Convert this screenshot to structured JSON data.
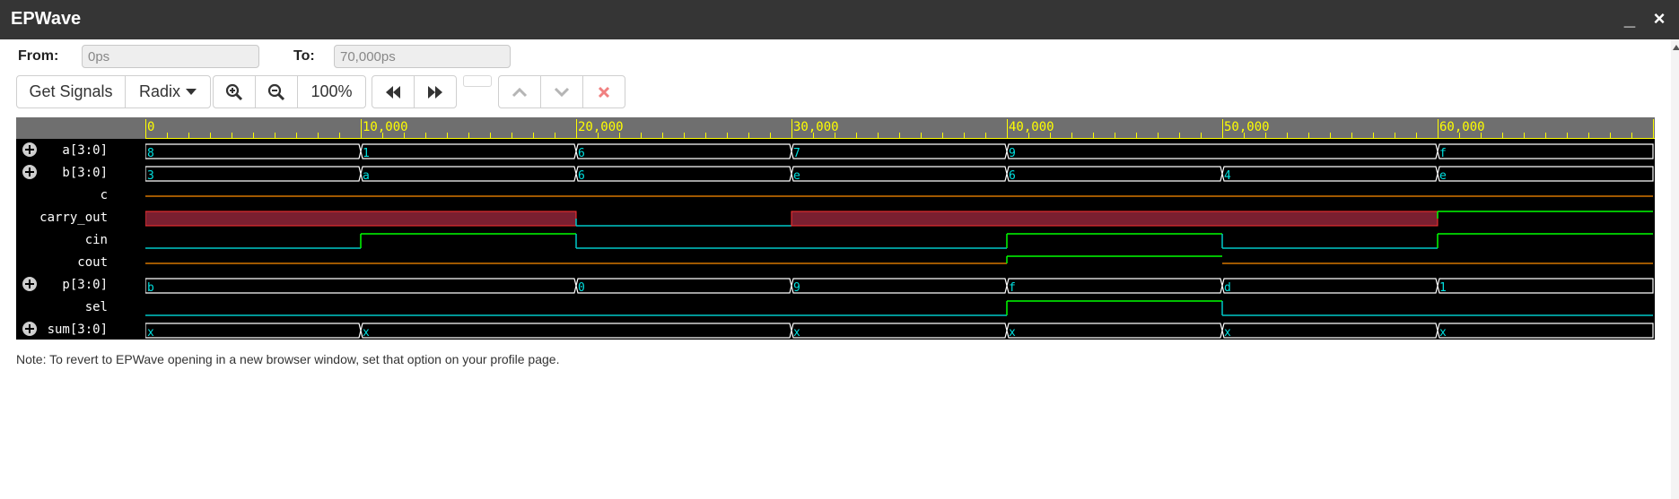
{
  "window": {
    "title": "EPWave",
    "minimize_glyph": "_",
    "close_glyph": "×"
  },
  "range": {
    "from_label": "From:",
    "from_value": "0ps",
    "to_label": "To:",
    "to_value": "70,000ps"
  },
  "toolbar": {
    "get_signals_label": "Get Signals",
    "radix_label": "Radix",
    "zoom_level": "100%",
    "icons": [
      "zoom-in-icon",
      "zoom-out-icon",
      "rewind-icon",
      "fast-forward-icon",
      "chevron-up-icon",
      "chevron-down-icon",
      "close-icon"
    ]
  },
  "waveform": {
    "time_start": 0,
    "time_end": 70000,
    "time_unit": "ps",
    "ruler_labels": [
      "0",
      "10,000",
      "20,000",
      "30,000",
      "40,000",
      "50,000",
      "60,000"
    ],
    "colors": {
      "background": "#000000",
      "bus": "#ffffff",
      "bus_value_text": "#00e0e0",
      "ruler": "#6f6f6f",
      "ruler_text": "#ffff00",
      "zero_line": "#00c8c8",
      "one_line": "#00ff00",
      "undefined_line": "#ff8c00",
      "unknown_fill": "#7a1f30",
      "unknown_edge": "#ff3030"
    },
    "signals": [
      {
        "name": "a[3:0]",
        "kind": "bus",
        "expandable": true,
        "segments": [
          {
            "start": 0,
            "value": "8"
          },
          {
            "start": 10000,
            "value": "1"
          },
          {
            "start": 20000,
            "value": "6"
          },
          {
            "start": 30000,
            "value": "7"
          },
          {
            "start": 40000,
            "value": "9"
          },
          {
            "start": 60000,
            "value": "f"
          }
        ]
      },
      {
        "name": "b[3:0]",
        "kind": "bus",
        "expandable": true,
        "segments": [
          {
            "start": 0,
            "value": "3"
          },
          {
            "start": 10000,
            "value": "a"
          },
          {
            "start": 20000,
            "value": "6"
          },
          {
            "start": 30000,
            "value": "e"
          },
          {
            "start": 40000,
            "value": "6"
          },
          {
            "start": 50000,
            "value": "4"
          },
          {
            "start": 60000,
            "value": "e"
          }
        ]
      },
      {
        "name": "c",
        "kind": "bit",
        "expandable": false,
        "segments": [
          {
            "start": 0,
            "value": "z"
          }
        ]
      },
      {
        "name": "carry_out",
        "kind": "bit",
        "expandable": false,
        "segments": [
          {
            "start": 0,
            "value": "x"
          },
          {
            "start": 20000,
            "value": "0"
          },
          {
            "start": 30000,
            "value": "x"
          },
          {
            "start": 60000,
            "value": "1"
          }
        ]
      },
      {
        "name": "cin",
        "kind": "bit",
        "expandable": false,
        "segments": [
          {
            "start": 0,
            "value": "0"
          },
          {
            "start": 10000,
            "value": "1"
          },
          {
            "start": 20000,
            "value": "0"
          },
          {
            "start": 40000,
            "value": "1"
          },
          {
            "start": 50000,
            "value": "0"
          },
          {
            "start": 60000,
            "value": "1"
          }
        ]
      },
      {
        "name": "cout",
        "kind": "bit",
        "expandable": false,
        "segments": [
          {
            "start": 0,
            "value": "z"
          },
          {
            "start": 40000,
            "value": "1"
          },
          {
            "start": 50000,
            "value": "z"
          }
        ]
      },
      {
        "name": "p[3:0]",
        "kind": "bus",
        "expandable": true,
        "segments": [
          {
            "start": 0,
            "value": "b"
          },
          {
            "start": 20000,
            "value": "0"
          },
          {
            "start": 30000,
            "value": "9"
          },
          {
            "start": 40000,
            "value": "f"
          },
          {
            "start": 50000,
            "value": "d"
          },
          {
            "start": 60000,
            "value": "1"
          }
        ]
      },
      {
        "name": "sel",
        "kind": "bit",
        "expandable": false,
        "segments": [
          {
            "start": 0,
            "value": "0"
          },
          {
            "start": 40000,
            "value": "1"
          },
          {
            "start": 50000,
            "value": "0"
          }
        ]
      },
      {
        "name": "sum[3:0]",
        "kind": "bus",
        "expandable": true,
        "segments": [
          {
            "start": 0,
            "value": "x"
          },
          {
            "start": 10000,
            "value": "x"
          },
          {
            "start": 30000,
            "value": "x"
          },
          {
            "start": 40000,
            "value": "x"
          },
          {
            "start": 50000,
            "value": "x"
          },
          {
            "start": 60000,
            "value": "x"
          }
        ]
      }
    ]
  },
  "note": "Note: To revert to EPWave opening in a new browser window, set that option on your profile page."
}
